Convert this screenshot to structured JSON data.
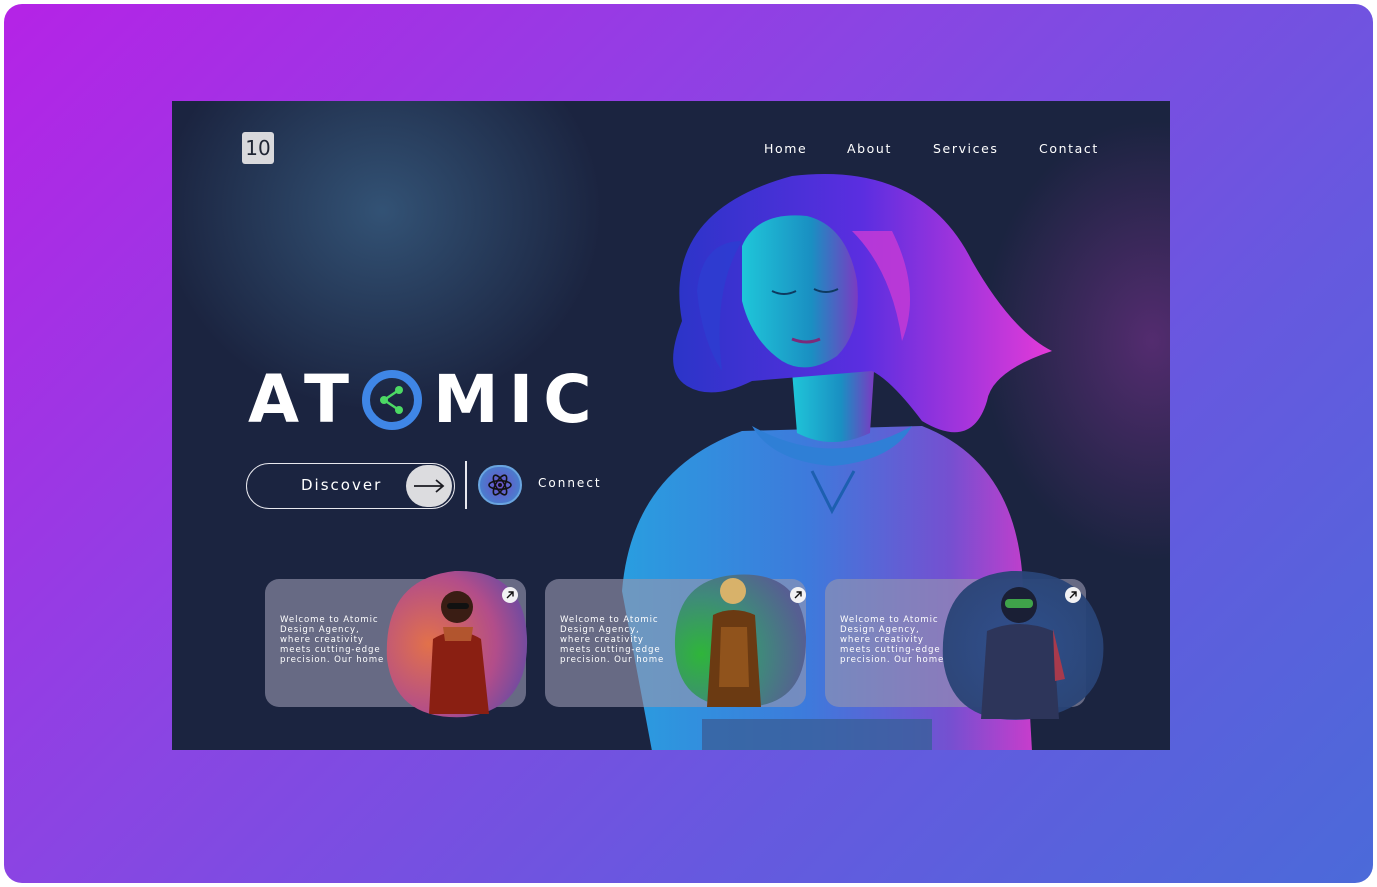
{
  "brand": {
    "logo_text": "10"
  },
  "nav": {
    "items": [
      "Home",
      "About",
      "Services",
      "Contact"
    ]
  },
  "hero": {
    "title_part1": "AT",
    "title_part2": "MIC",
    "discover_label": "Discover",
    "connect_label": "Connect"
  },
  "cards": [
    {
      "text": "Welcome to Atomic Design Agency, where creativity meets cutting-edge precision. Our home",
      "accent": "#e26a4a"
    },
    {
      "text": "Welcome to Atomic Design Agency, where creativity meets cutting-edge precision. Our home",
      "accent": "#2fb53a"
    },
    {
      "text": "Welcome to Atomic Design Agency, where creativity meets cutting-edge precision. Our home",
      "accent": "#2b4e8c"
    }
  ],
  "colors": {
    "background_gradient_start": "#b523e6",
    "background_gradient_end": "#4b6ad9",
    "hero_bg": "#1b2440",
    "o_ring": "#3f86e6",
    "o_accent": "#4cd964"
  },
  "icons": [
    "logo-badge",
    "arrow-right-icon",
    "react-atom-icon",
    "share-nodes-icon",
    "arrow-up-right-icon"
  ]
}
